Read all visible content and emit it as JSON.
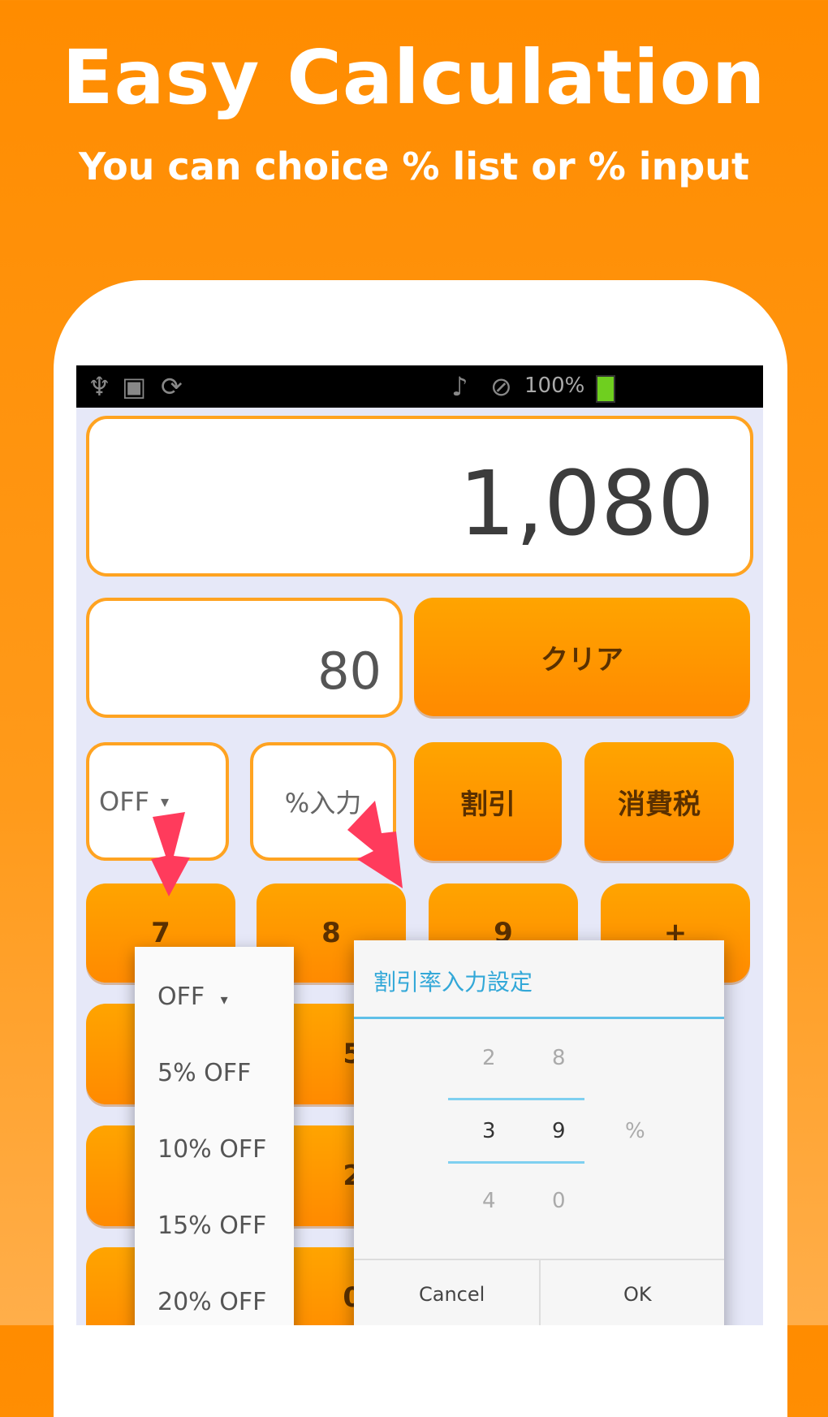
{
  "hero": {
    "title": "Easy Calculation",
    "subtitle": "You can choice % list or % input"
  },
  "statusbar": {
    "battery_text": "100%",
    "icons": [
      "usb-icon",
      "image-icon",
      "sync-icon",
      "mute-icon",
      "alarm-icon",
      "battery-icon"
    ]
  },
  "calculator": {
    "display_value": "1,080",
    "input_value": "80",
    "clear_label": "クリア",
    "percent_select_value": "OFF",
    "percent_input_label": "%入力",
    "discount_label": "割引",
    "tax_label": "消費税",
    "keys_row1": [
      "7",
      "8",
      "9",
      "+"
    ],
    "keys_col_middle": [
      "5",
      "2",
      "0"
    ]
  },
  "dropdown": {
    "items": [
      "OFF",
      "5% OFF",
      "10% OFF",
      "15% OFF",
      "20% OFF"
    ]
  },
  "dialog": {
    "title": "割引率入力設定",
    "picker_tens": [
      "2",
      "3",
      "4"
    ],
    "picker_ones": [
      "8",
      "9",
      "0"
    ],
    "unit": "%",
    "cancel": "Cancel",
    "ok": "OK"
  },
  "colors": {
    "background": "#ff8c00",
    "accent_orange": "#ffa321",
    "arrow_red": "#ff3b5c",
    "dialog_blue": "#33a8d8"
  }
}
